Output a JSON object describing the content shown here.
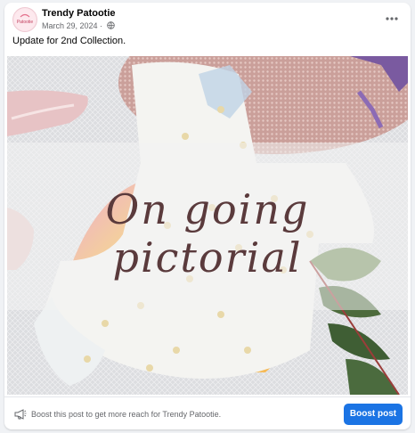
{
  "post": {
    "page_name": "Trendy Patootie",
    "date": "March 29, 2024",
    "separator": " · ",
    "caption": "Update for 2nd Collection.",
    "overlay_text": "On going pictorial",
    "avatar_text": "Patootie"
  },
  "footer": {
    "boost_text": "Boost this post to get more reach for Trendy Patootie.",
    "boost_button_label": "Boost post"
  },
  "icons": {
    "more": "more-options-icon",
    "audience": "globe-icon",
    "boost": "megaphone-icon"
  },
  "colors": {
    "accent": "#1b74e4",
    "text_primary": "#050505",
    "text_secondary": "#65676b"
  }
}
